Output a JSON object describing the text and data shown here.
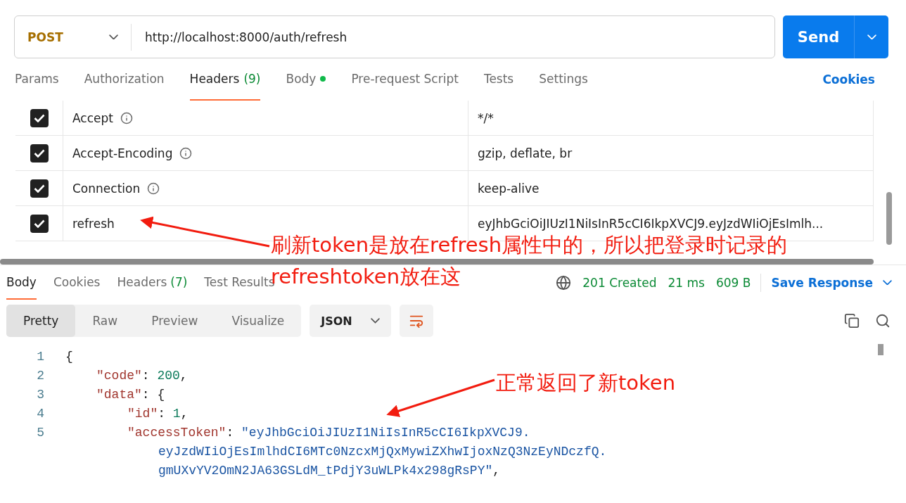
{
  "request": {
    "method": "POST",
    "url": "http://localhost:8000/auth/refresh",
    "send_label": "Send"
  },
  "request_tabs": [
    {
      "label": "Params",
      "selected": false
    },
    {
      "label": "Authorization",
      "selected": false
    },
    {
      "label": "Headers",
      "count": "(9)",
      "selected": true
    },
    {
      "label": "Body",
      "dot": true,
      "selected": false
    },
    {
      "label": "Pre-request Script",
      "selected": false
    },
    {
      "label": "Tests",
      "selected": false
    },
    {
      "label": "Settings",
      "selected": false
    }
  ],
  "cookies_link": "Cookies",
  "headers": [
    {
      "key": "Accept",
      "info": true,
      "value": "*/*",
      "checked": true
    },
    {
      "key": "Accept-Encoding",
      "info": true,
      "value": "gzip, deflate, br",
      "checked": true
    },
    {
      "key": "Connection",
      "info": true,
      "value": "keep-alive",
      "checked": true
    },
    {
      "key": "refresh",
      "info": false,
      "value": "eyJhbGciOiJIUzI1NiIsInR5cCI6IkpXVCJ9.eyJzdWIiOjEsImlh...",
      "checked": true
    }
  ],
  "response_tabs": [
    {
      "label": "Body",
      "selected": true
    },
    {
      "label": "Cookies",
      "selected": false
    },
    {
      "label": "Headers",
      "count": "(7)",
      "selected": false
    },
    {
      "label": "Test Results",
      "selected": false
    }
  ],
  "status": {
    "code": "201 Created",
    "time": "21 ms",
    "size": "609 B"
  },
  "save_response": "Save Response",
  "view_modes": [
    {
      "label": "Pretty",
      "selected": true
    },
    {
      "label": "Raw",
      "selected": false
    },
    {
      "label": "Preview",
      "selected": false
    },
    {
      "label": "Visualize",
      "selected": false
    }
  ],
  "format": "JSON",
  "code_lines": [
    {
      "number": "1",
      "segments": [
        {
          "kind": "punct",
          "text": "{"
        }
      ]
    },
    {
      "number": "2",
      "segments": [
        {
          "kind": "key",
          "text": "\"code\""
        },
        {
          "kind": "punct",
          "text": ": "
        },
        {
          "kind": "number",
          "text": "200"
        },
        {
          "kind": "punct",
          "text": ","
        }
      ]
    },
    {
      "number": "3",
      "segments": [
        {
          "kind": "key",
          "text": "\"data\""
        },
        {
          "kind": "punct",
          "text": ": {"
        }
      ]
    },
    {
      "number": "4",
      "segments": [
        {
          "kind": "key",
          "text": "\"id\""
        },
        {
          "kind": "punct",
          "text": ": "
        },
        {
          "kind": "number",
          "text": "1"
        },
        {
          "kind": "punct",
          "text": ","
        }
      ]
    },
    {
      "number": "5",
      "segments": [
        {
          "kind": "key",
          "text": "\"accessToken\""
        },
        {
          "kind": "punct",
          "text": ": "
        },
        {
          "kind": "string",
          "text": "\"eyJhbGciOiJIUzI1NiIsInR5cCI6IkpXVCJ9."
        }
      ]
    },
    {
      "segments": [
        {
          "kind": "string",
          "text": "eyJzdWIiOjEsImlhdCI6MTc0NzcxMjQxMywiZXhwIjoxNzQ3NzEyNDczfQ."
        }
      ]
    },
    {
      "segments": [
        {
          "kind": "string",
          "text": "gmUXvYV2OmN2JA63GSLdM_tPdjY3uWLPk4x298gRsPY\""
        },
        {
          "kind": "punct",
          "text": ","
        }
      ]
    }
  ],
  "annotations": [
    {
      "lines": [
        "刷新token是放在refresh属性中的，所以把登录时记录的",
        "refreshtoken放在这"
      ]
    },
    {
      "lines": [
        "正常返回了新token"
      ]
    }
  ]
}
